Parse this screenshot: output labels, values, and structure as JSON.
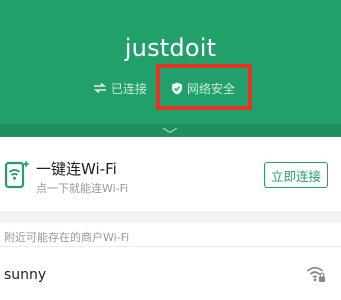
{
  "header": {
    "ssid": "justdoit",
    "status_connected": "已连接",
    "status_secure": "网络安全",
    "bg_color": "#22a06c",
    "highlight_color": "#e53323"
  },
  "oneclick": {
    "title": "一键连Wi-Fi",
    "subtitle": "点一下就能连Wi-Fi",
    "button_label": "立即连接",
    "icon": "wifi-phone-icon"
  },
  "nearby": {
    "section_title": "附近可能存在的商户Wi-Fi",
    "items": [
      {
        "name": "sunny",
        "icon": "wifi-locked-signal-icon"
      }
    ]
  }
}
